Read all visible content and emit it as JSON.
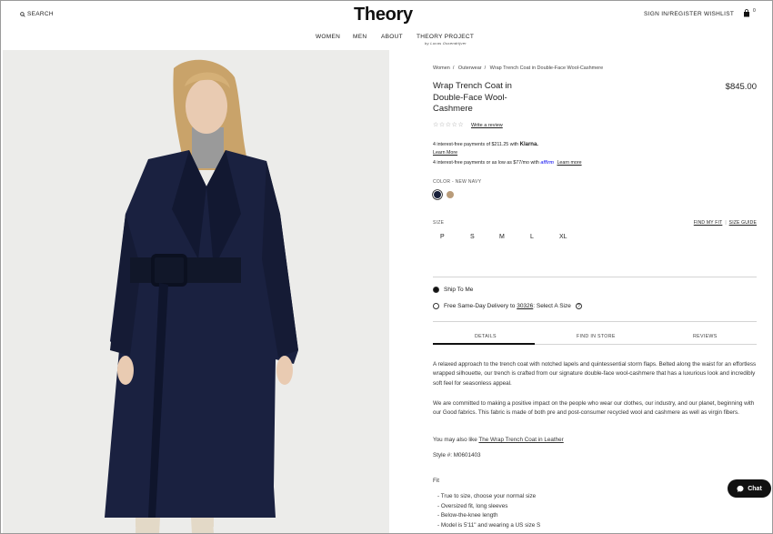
{
  "header": {
    "search_label": "SEARCH",
    "logo": "Theory",
    "signin": "SIGN IN/REGISTER",
    "wishlist": "WISHLIST",
    "bag_count": "0",
    "nav": [
      "WOMEN",
      "MEN",
      "ABOUT",
      "THEORY PROJECT"
    ],
    "nav_sub": "by Lucas Ossendrijver"
  },
  "product": {
    "breadcrumbs": [
      "Women",
      "Outerwear",
      "Wrap Trench Coat in Double-Face Wool-Cashmere"
    ],
    "title": "Wrap Trench Coat in Double-Face Wool-Cashmere",
    "price": "$845.00",
    "stars": "☆☆☆☆☆",
    "write_review": "Write a review",
    "klarna_text": "4 interest-free payments of $211.25 with",
    "klarna_brand": "Klarna.",
    "klarna_learn": "Learn More",
    "affirm_text": "4 interest-free payments or as low as $77/mo with",
    "affirm_brand": "affirm",
    "affirm_learn": "Learn more",
    "color_label": "COLOR - NEW NAVY",
    "colors": [
      "#18203a",
      "#b99c7a"
    ],
    "size_label": "SIZE",
    "find_my_fit": "FIND MY FIT",
    "size_guide": "SIZE GUIDE",
    "sizes": [
      "P",
      "S",
      "M",
      "L",
      "XL"
    ],
    "ship_to_me": "Ship To Me",
    "same_day_prefix": "Free Same-Day Delivery to",
    "zip": "30326",
    "same_day_suffix": ": Select A Size",
    "tabs": [
      "DETAILS",
      "FIND IN STORE",
      "REVIEWS"
    ],
    "desc1": "A relaxed approach to the trench coat with notched lapels and quintessential storm flaps. Belted along the waist for an effortless wrapped silhouette, our trench is crafted from our signature double-face wool-cashmere that has a luxurious look and incredibly soft feel for seasonless appeal.",
    "desc2": "We are committed to making a positive impact on the people who wear our clothes, our industry, and our planet, beginning with our Good fabrics. This fabric is made of both pre and post-consumer recycled wool and cashmere as well as virgin fibers.",
    "also_like_prefix": "You may also like",
    "also_like_link": "The Wrap Trench Coat in Leather",
    "style_number": "Style #:  M0601403",
    "fit_heading": "Fit",
    "fit_items": [
      "- True to size, choose your normal size",
      "- Oversized fit, long sleeves",
      "- Below-the-knee length",
      "- Model is 5'11\" and wearing a US size S"
    ]
  },
  "chat": {
    "label": "Chat"
  }
}
